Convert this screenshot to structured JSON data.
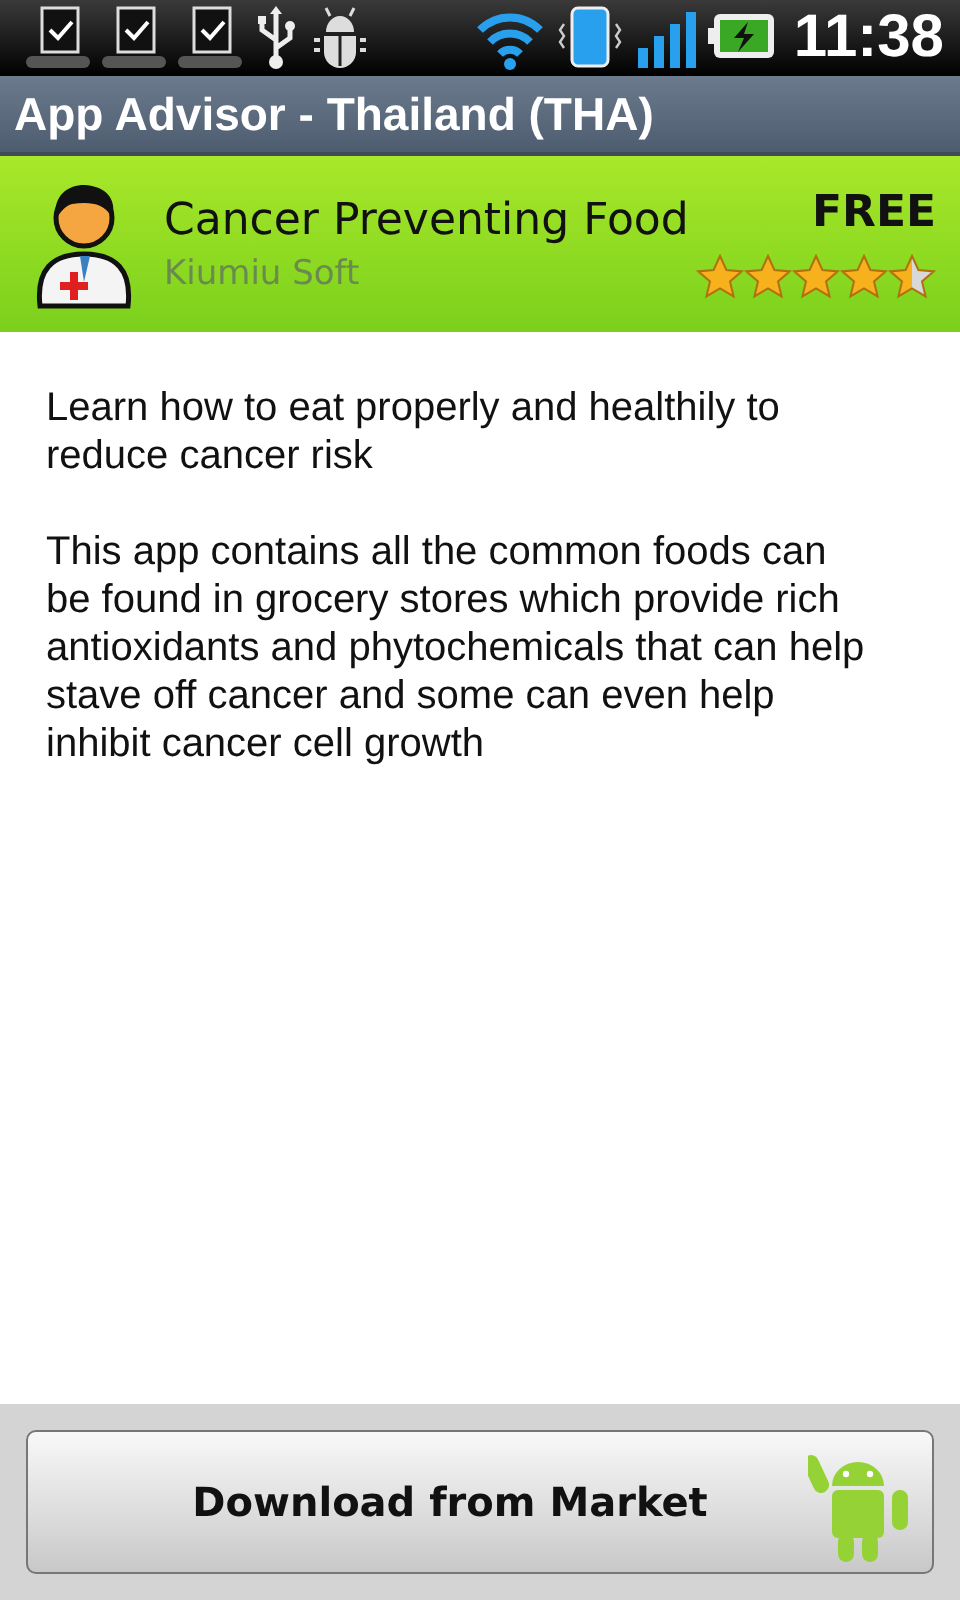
{
  "status_bar": {
    "time": "11:38"
  },
  "title_bar": {
    "title": "App Advisor - Thailand (THA)"
  },
  "app": {
    "name": "Cancer Preventing Food",
    "developer": "Kiumiu Soft",
    "price": "FREE",
    "stars": 4.5
  },
  "description": [
    "Learn how to eat properly and healthily to reduce cancer risk",
    "This app contains all the common foods can be found in grocery stores which provide rich antioxidants and phytochemicals that can help stave off cancer and some can even help inhibit cancer cell growth"
  ],
  "download_button": {
    "label": "Download from Market"
  }
}
